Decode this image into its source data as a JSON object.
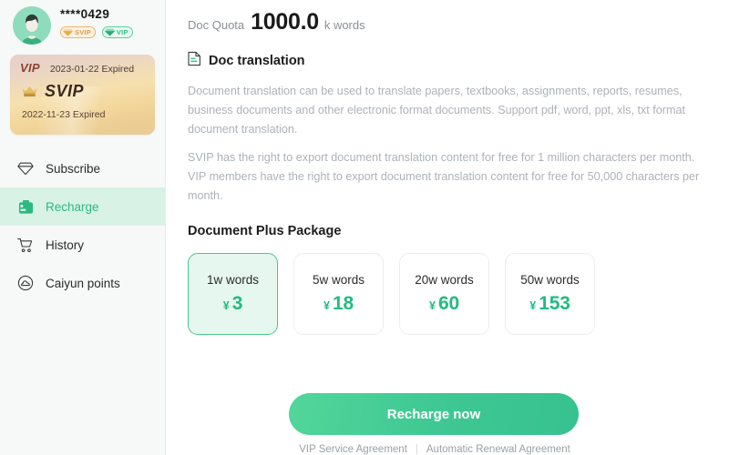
{
  "sidebar": {
    "profile": {
      "username": "****0429",
      "avatar_icon": "user-avatar",
      "badges": [
        {
          "label": "SVIP",
          "icon": "gem-icon",
          "color": "#e39a4a"
        },
        {
          "label": "VIP",
          "icon": "gem-icon",
          "color": "#3cbb86"
        }
      ]
    },
    "vip_card": {
      "vip_tag": "VIP",
      "vip_date": "2023-01-22 Expired",
      "crown_icon": "crown-icon",
      "svip_tag": "SVIP",
      "svip_date": "2022-11-23 Expired"
    },
    "items": [
      {
        "label": "Subscribe",
        "icon": "gem-outline-icon",
        "active": false
      },
      {
        "label": "Recharge",
        "icon": "wallet-icon",
        "active": true
      },
      {
        "label": "History",
        "icon": "cart-icon",
        "active": false
      },
      {
        "label": "Caiyun points",
        "icon": "cloud-circle-icon",
        "active": false
      }
    ]
  },
  "main": {
    "quota": {
      "label": "Doc Quota",
      "value": "1000.0",
      "unit": "k words"
    },
    "section": {
      "icon": "document-icon",
      "title": "Doc translation",
      "paragraphs": [
        "Document translation can be used to translate papers, textbooks, assignments, reports, resumes, business documents and other electronic format documents. Support pdf, word, ppt, xls, txt format document translation.",
        "SVIP has the right to export document translation content for free for 1 million characters per month. VIP members have the right to export document translation content for free for 50,000 characters per month."
      ]
    },
    "packages": {
      "title": "Document Plus Package",
      "currency": "¥",
      "items": [
        {
          "words": "1w words",
          "price": "3",
          "selected": true
        },
        {
          "words": "5w words",
          "price": "18",
          "selected": false
        },
        {
          "words": "20w words",
          "price": "60",
          "selected": false
        },
        {
          "words": "50w words",
          "price": "153",
          "selected": false
        }
      ]
    },
    "cta": {
      "label": "Recharge now"
    },
    "legal": {
      "service_agreement": "VIP Service Agreement",
      "divider": "|",
      "renewal_agreement": "Automatic Renewal Agreement"
    }
  },
  "colors": {
    "accent_green": "#2bb97f",
    "price_green": "#22bb80",
    "selected_bg": "#e6f7ef",
    "selected_border": "#49c98c",
    "sidebar_bg": "#f7f8f8",
    "muted_text": "#adb2b8"
  }
}
